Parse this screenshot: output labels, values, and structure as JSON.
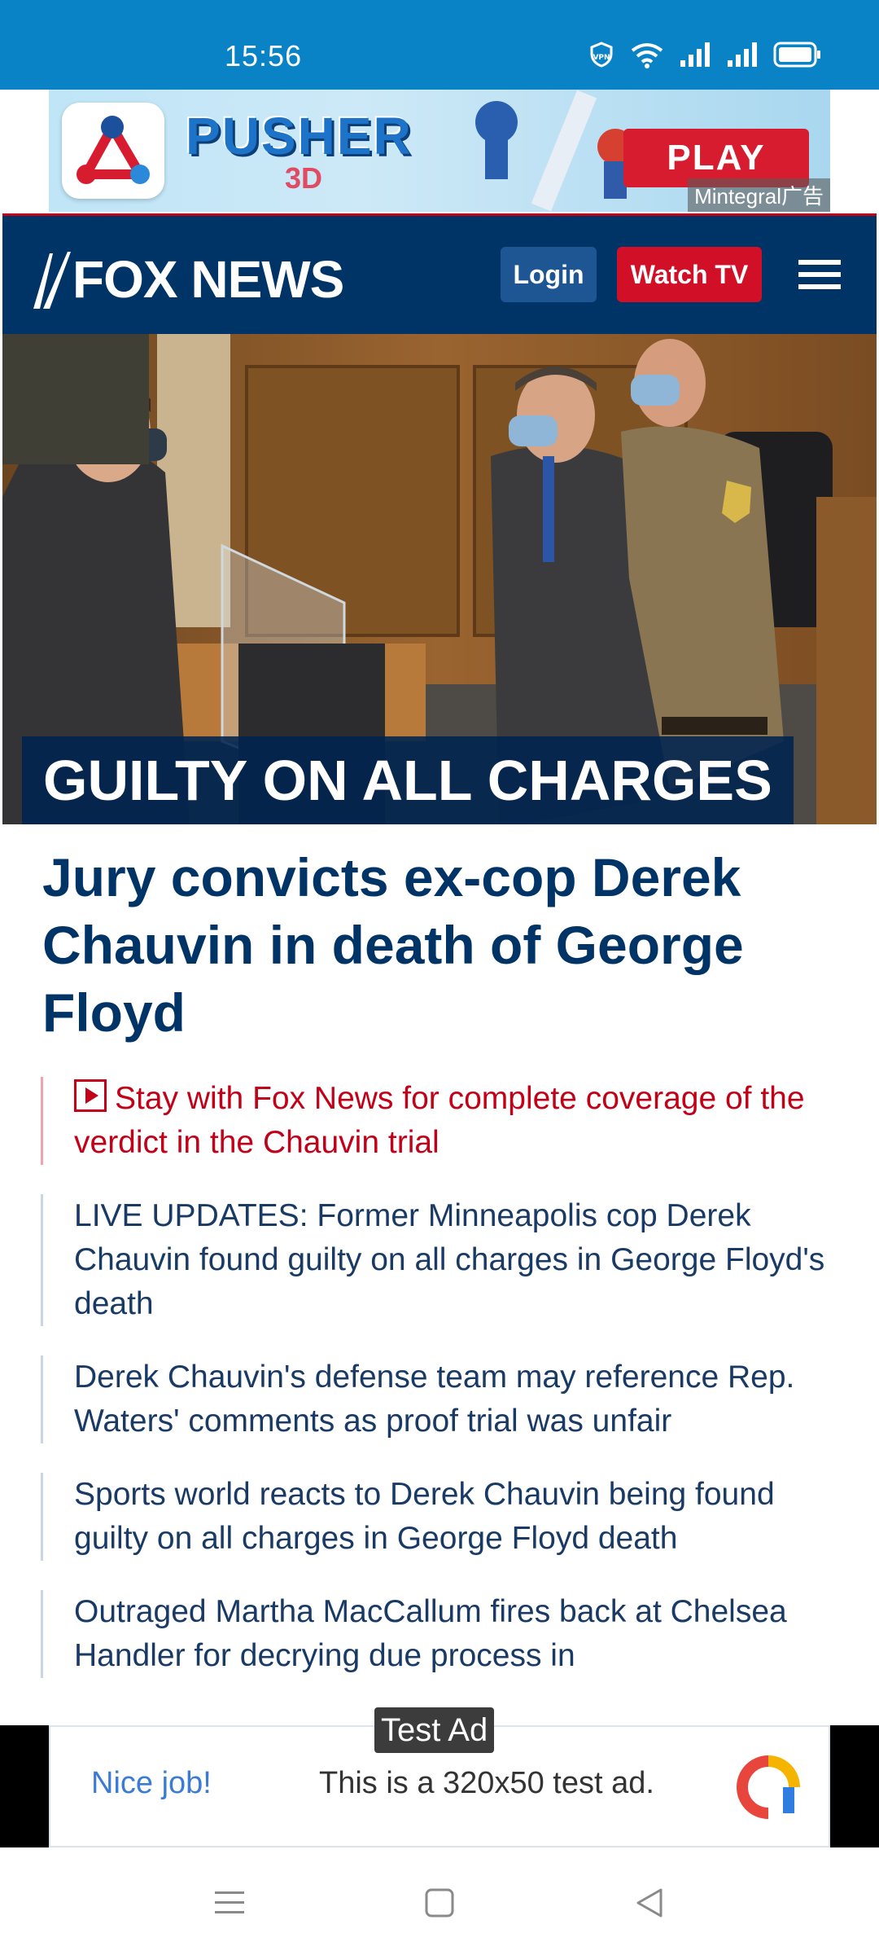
{
  "status_bar": {
    "time": "15:56",
    "icons": [
      "vpn-icon",
      "wifi-icon",
      "signal-icon",
      "signal-icon",
      "battery-icon"
    ]
  },
  "top_ad": {
    "title": "PUSHER",
    "subtitle": "3D",
    "cta": "PLAY",
    "source": "Mintegral广告"
  },
  "header": {
    "logo": "FOX NEWS",
    "login_label": "Login",
    "watch_label": "Watch TV",
    "menu_icon": "hamburger-icon"
  },
  "hero": {
    "headline": "GUILTY ON ALL CHARGES"
  },
  "article": {
    "title": "Jury convicts ex-cop Derek Chauvin in death of George Floyd",
    "related": [
      "Stay with Fox News for complete coverage of the verdict in the Chauvin trial",
      "LIVE UPDATES: Former Minneapolis cop Derek Chauvin found guilty on all charges in George Floyd's death",
      "Derek Chauvin's defense team may reference Rep. Waters' comments as proof trial was unfair",
      "Sports world reacts to Derek Chauvin being found guilty on all charges in George Floyd death",
      "Outraged Martha MacCallum fires back at Chelsea Handler for decrying due process in"
    ]
  },
  "bottom_ad": {
    "label": "Test Ad",
    "left_text": "Nice job!",
    "text": "This is a 320x50 test ad."
  },
  "colors": {
    "status_bar": "#0a83c6",
    "brand_navy": "#003366",
    "brand_red": "#c20017"
  }
}
